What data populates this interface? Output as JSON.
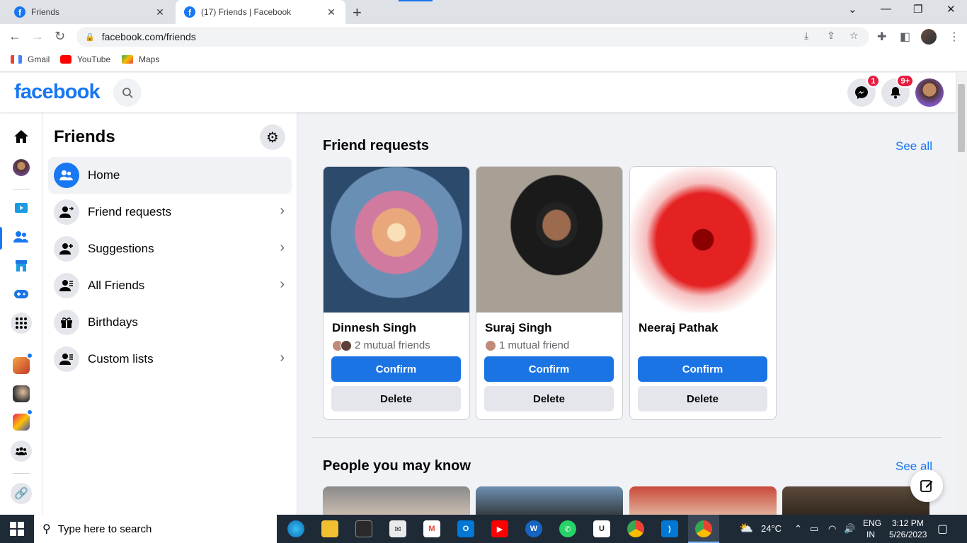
{
  "browser": {
    "tabs": [
      {
        "title": "Friends"
      },
      {
        "title": "(17) Friends | Facebook"
      }
    ],
    "url": "facebook.com/friends",
    "bookmarks": [
      {
        "label": "Gmail"
      },
      {
        "label": "YouTube"
      },
      {
        "label": "Maps"
      }
    ]
  },
  "header": {
    "logo": "facebook",
    "messenger_badge": "1",
    "notifications_badge": "9+"
  },
  "sidebar": {
    "title": "Friends",
    "items": [
      {
        "label": "Home",
        "icon": "friends-icon"
      },
      {
        "label": "Friend requests",
        "icon": "friend-request-icon"
      },
      {
        "label": "Suggestions",
        "icon": "add-friend-icon"
      },
      {
        "label": "All Friends",
        "icon": "friend-list-icon"
      },
      {
        "label": "Birthdays",
        "icon": "gift-icon"
      },
      {
        "label": "Custom lists",
        "icon": "friend-list-icon"
      }
    ]
  },
  "main": {
    "friend_requests": {
      "title": "Friend requests",
      "see_all": "See all",
      "cards": [
        {
          "name": "Dinnesh Singh",
          "mutual": "2 mutual friends",
          "confirm": "Confirm",
          "delete": "Delete"
        },
        {
          "name": "Suraj Singh",
          "mutual": "1 mutual friend",
          "confirm": "Confirm",
          "delete": "Delete"
        },
        {
          "name": "Neeraj Pathak",
          "mutual": "",
          "confirm": "Confirm",
          "delete": "Delete"
        }
      ]
    },
    "people_you_may_know": {
      "title": "People you may know",
      "see_all": "See all"
    }
  },
  "taskbar": {
    "search_placeholder": "Type here to search",
    "weather": "24°C",
    "lang_top": "ENG",
    "lang_bottom": "IN",
    "time": "3:12 PM",
    "date": "5/26/2023"
  },
  "colors": {
    "facebook_blue": "#1877f2",
    "badge_red": "#e41e3f"
  }
}
